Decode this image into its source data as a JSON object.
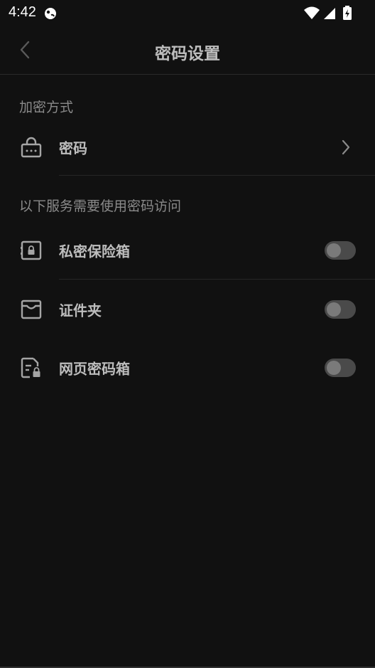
{
  "status_bar": {
    "time": "4:42"
  },
  "header": {
    "title": "密码设置"
  },
  "sections": [
    {
      "title": "加密方式"
    },
    {
      "title": "以下服务需要使用密码访问"
    }
  ],
  "encryption_item": {
    "label": "密码",
    "icon": "lock-keypad-icon"
  },
  "services": [
    {
      "label": "私密保险箱",
      "icon": "safe-icon",
      "enabled": false
    },
    {
      "label": "证件夹",
      "icon": "card-holder-icon",
      "enabled": false
    },
    {
      "label": "网页密码箱",
      "icon": "web-password-icon",
      "enabled": false
    }
  ]
}
